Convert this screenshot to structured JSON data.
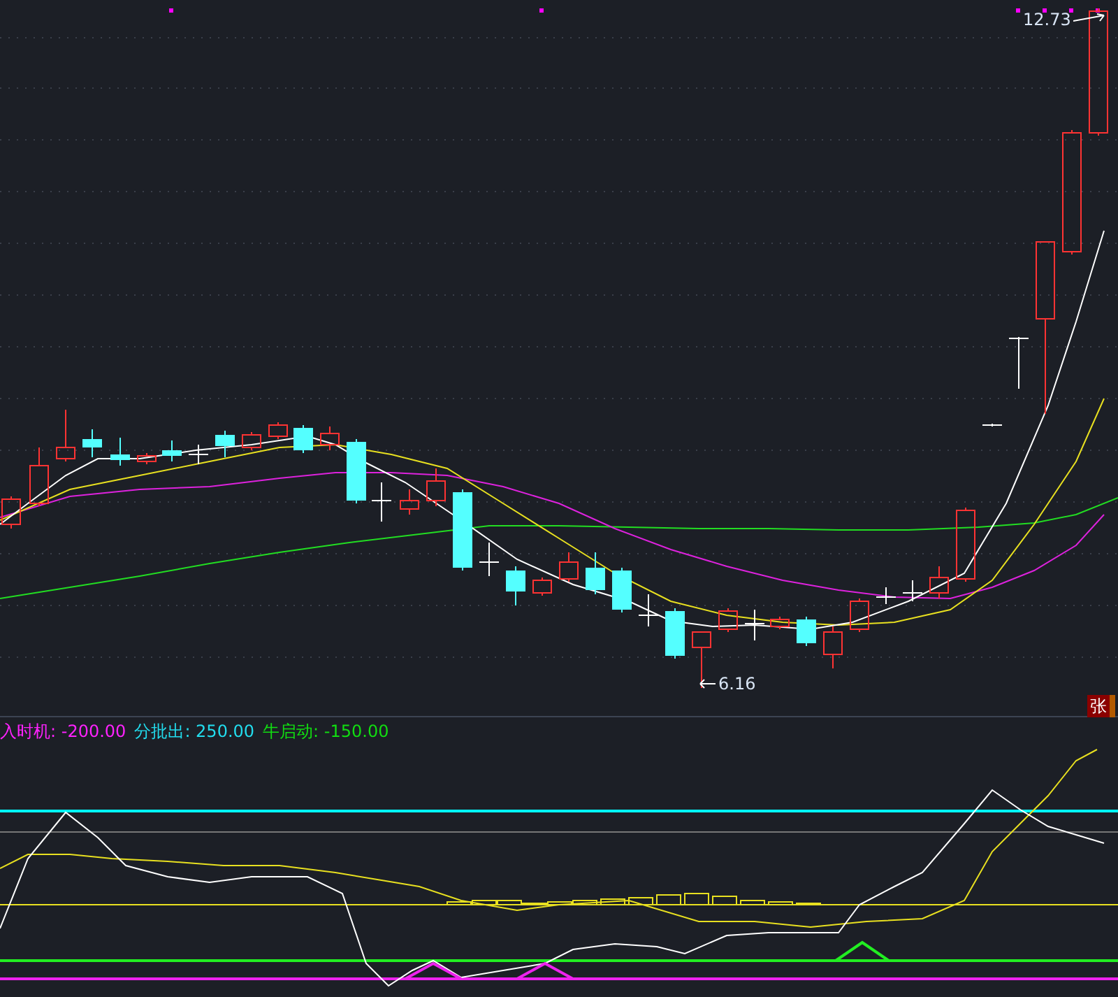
{
  "price_labels": [
    {
      "text": "12.73",
      "kind": "high"
    },
    {
      "text": "6.16",
      "kind": "low"
    }
  ],
  "indicator_legend": [
    {
      "text": "入时机: -200.00",
      "color": "#ff22ff"
    },
    {
      "text": "分批出: 250.00",
      "color": "#22ddee"
    },
    {
      "text": "牛启动: -150.00",
      "color": "#11dd11"
    }
  ],
  "badge": {
    "text": "张"
  }
}
